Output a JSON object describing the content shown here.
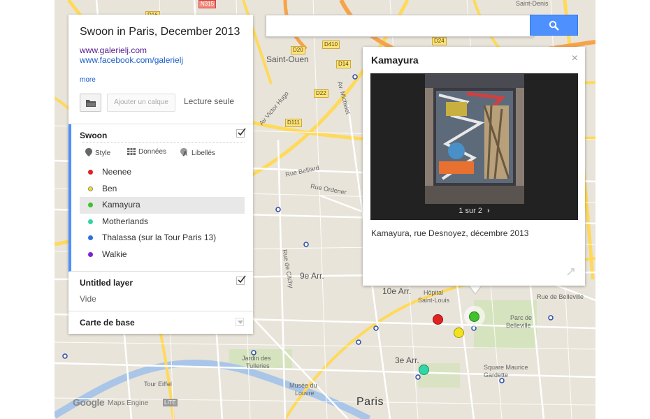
{
  "map": {
    "labels": {
      "saint_ouen": "Saint-Ouen",
      "nine_arr": "9e Arr.",
      "ten_arr": "10e Arr.",
      "three_arr": "3e Arr.",
      "paris": "Paris",
      "parc_belleville_1": "Parc de",
      "parc_belleville_2": "Belleville",
      "square_maurice_1": "Square Maurice",
      "square_maurice_2": "Gardette",
      "tuileries_1": "Jardin des",
      "tuileries_2": "Tuileries",
      "musee_louvre_1": "Musée du",
      "musee_louvre_2": "Louvre",
      "tour_eiffel": "Tour Eiffel",
      "hopital_1": "Hôpital",
      "hopital_2": "Saint-Louis",
      "av_victor_hugo": "Av Victor Hugo",
      "rue_belliard": "Rue Belliard",
      "rue_ordener": "Rue Ordener",
      "rue_de_belleville": "Rue de Belleville",
      "av_michelet": "Av. Michelet",
      "rue_de_clichy": "Rue de Clichy",
      "saint_denis": "Saint-Denis",
      "d20": "D20",
      "d410": "D410",
      "d14": "D14",
      "d24": "D24",
      "d22": "D22",
      "d111": "D111",
      "n315": "N315",
      "d16": "D16"
    }
  },
  "search": {
    "placeholder": ""
  },
  "panel": {
    "title": "Swoon in Paris, December 2013",
    "links": [
      "www.galerielj.com",
      "www.facebook.com/galerielj"
    ],
    "more": "more",
    "add_layer": "Ajouter un calque",
    "read_only": "Lecture seule"
  },
  "layers": {
    "swoon": {
      "title": "Swoon",
      "tools": [
        "Style",
        "Données",
        "Libellés"
      ],
      "items": [
        {
          "label": "Neenee",
          "color": "#e02222"
        },
        {
          "label": "Ben",
          "color": "#f2e21c"
        },
        {
          "label": "Kamayura",
          "color": "#3ec32b"
        },
        {
          "label": "Motherlands",
          "color": "#2fd6a6"
        },
        {
          "label": "Thalassa (sur la Tour Paris 13)",
          "color": "#2f6fde"
        },
        {
          "label": "Walkie",
          "color": "#7b22d6"
        }
      ],
      "selected": "Kamayura"
    },
    "untitled": {
      "title": "Untitled layer",
      "empty": "Vide"
    },
    "base": {
      "title": "Carte de base"
    }
  },
  "card": {
    "title": "Kamayura",
    "close": "×",
    "pager": "1 sur 2",
    "caption": "Kamayura, rue Desnoyez, décembre 2013"
  },
  "branding": {
    "google": "Google",
    "maps_engine": "Maps Engine",
    "lite": "LITE"
  }
}
